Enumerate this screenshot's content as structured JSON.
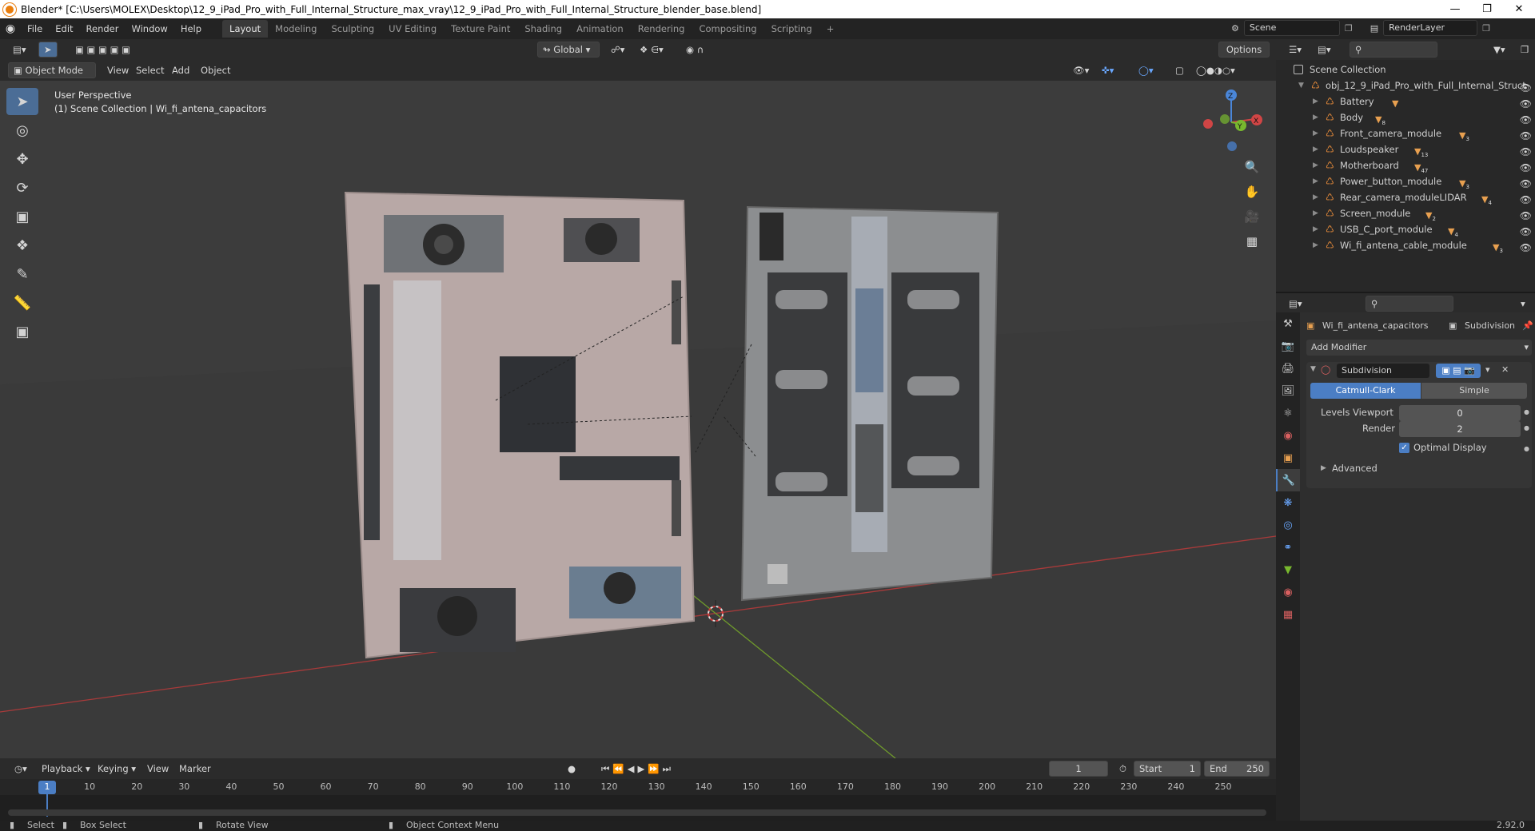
{
  "window": {
    "title": "Blender* [C:\\Users\\MOLEX\\Desktop\\12_9_iPad_Pro_with_Full_Internal_Structure_max_vray\\12_9_iPad_Pro_with_Full_Internal_Structure_blender_base.blend]"
  },
  "menu": [
    "File",
    "Edit",
    "Render",
    "Window",
    "Help"
  ],
  "workspaces": [
    "Layout",
    "Modeling",
    "Sculpting",
    "UV Editing",
    "Texture Paint",
    "Shading",
    "Animation",
    "Rendering",
    "Compositing",
    "Scripting"
  ],
  "scene": {
    "name": "Scene",
    "view_layer": "RenderLayer"
  },
  "header3d": {
    "mode": "Object Mode",
    "menus": [
      "View",
      "Select",
      "Add",
      "Object"
    ],
    "orientation": "Global",
    "options": "Options"
  },
  "viewport": {
    "perspective": "User Perspective",
    "collection": "(1) Scene Collection | Wi_fi_antena_capacitors",
    "gizmo": {
      "x": "X",
      "y": "Y",
      "z": "Z"
    }
  },
  "outliner": {
    "root": "Scene Collection",
    "object": "obj_12_9_iPad_Pro_with_Full_Internal_Struct",
    "children": [
      {
        "name": "Battery",
        "badge": ""
      },
      {
        "name": "Body",
        "badge": "8"
      },
      {
        "name": "Front_camera_module",
        "badge": "3"
      },
      {
        "name": "Loudspeaker",
        "badge": "13"
      },
      {
        "name": "Motherboard",
        "badge": "47"
      },
      {
        "name": "Power_button_module",
        "badge": "3"
      },
      {
        "name": "Rear_camera_moduleLIDAR",
        "badge": "4"
      },
      {
        "name": "Screen_module",
        "badge": "2"
      },
      {
        "name": "USB_C_port_module",
        "badge": "4"
      },
      {
        "name": "Wi_fi_antena_cable_module",
        "badge": "3"
      }
    ]
  },
  "properties": {
    "object": "Wi_fi_antena_capacitors",
    "modifier_tab": "Subdivision",
    "add_modifier": "Add Modifier",
    "modifier_name": "Subdivision",
    "catmull": "Catmull-Clark",
    "simple": "Simple",
    "levels_viewport_label": "Levels Viewport",
    "levels_viewport": "0",
    "render_label": "Render",
    "render": "2",
    "optimal_display": "Optimal Display",
    "advanced": "Advanced"
  },
  "timeline": {
    "menus": [
      "Playback",
      "Keying",
      "View",
      "Marker"
    ],
    "current_frame": "1",
    "start_label": "Start",
    "start": "1",
    "end_label": "End",
    "end": "250",
    "ruler": [
      "1",
      "10",
      "20",
      "30",
      "40",
      "50",
      "60",
      "70",
      "80",
      "90",
      "100",
      "110",
      "120",
      "130",
      "140",
      "150",
      "160",
      "170",
      "180",
      "190",
      "200",
      "210",
      "220",
      "230",
      "240",
      "250"
    ]
  },
  "status": {
    "select": "Select",
    "box_select": "Box Select",
    "rotate_view": "Rotate View",
    "context_menu": "Object Context Menu",
    "version": "2.92.0"
  },
  "colors": {
    "accent": "#4b7ec4",
    "orange": "#e87d0d"
  }
}
